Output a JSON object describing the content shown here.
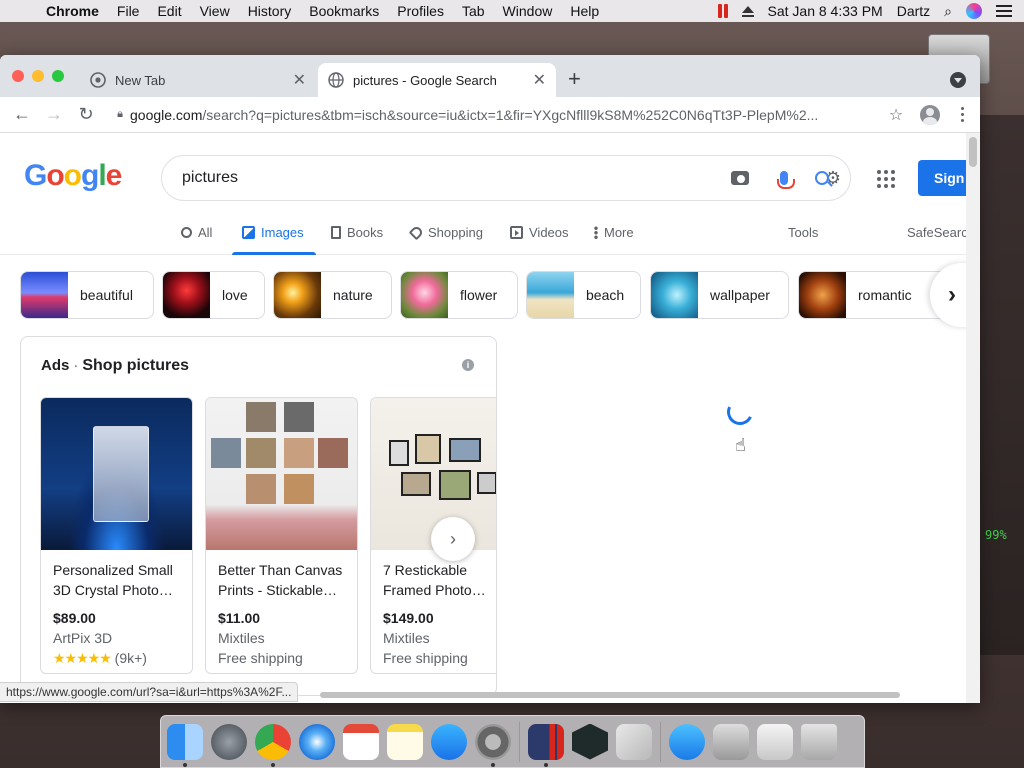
{
  "menubar": {
    "app": "Chrome",
    "items": [
      "File",
      "Edit",
      "View",
      "History",
      "Bookmarks",
      "Profiles",
      "Tab",
      "Window",
      "Help"
    ],
    "clock": "Sat Jan 8  4:33 PM",
    "user": "Dartz"
  },
  "desktop": {
    "battery_text": "99%"
  },
  "tabs": [
    {
      "title": "New Tab"
    },
    {
      "title": "pictures - Google Search"
    }
  ],
  "toolbar": {
    "url_domain": "google.com",
    "url_rest": "/search?q=pictures&tbm=isch&source=iu&ictx=1&fir=YXgcNflll9kS8M%252C0N6qTt3P-PlepM%2..."
  },
  "search": {
    "query": "pictures",
    "sign_in_label": "Sign"
  },
  "nav": {
    "all": "All",
    "images": "Images",
    "books": "Books",
    "shopping": "Shopping",
    "videos": "Videos",
    "more": "More",
    "tools": "Tools",
    "safesearch": "SafeSearch"
  },
  "chips": [
    {
      "label": "beautiful"
    },
    {
      "label": "love"
    },
    {
      "label": "nature"
    },
    {
      "label": "flower"
    },
    {
      "label": "beach"
    },
    {
      "label": "wallpaper"
    },
    {
      "label": "romantic"
    }
  ],
  "ads": {
    "ads_label": "Ads",
    "title": "Shop pictures",
    "products": [
      {
        "name": "Personalized Small 3D Crystal Photo…",
        "price": "$89.00",
        "seller": "ArtPix 3D",
        "stars": "★★★★★",
        "reviews": "(9k+)"
      },
      {
        "name": "Better Than Canvas Prints - Stickable…",
        "price": "$11.00",
        "seller": "Mixtiles",
        "shipping": "Free shipping"
      },
      {
        "name": "7 Restickable Framed Photo…",
        "price": "$149.00",
        "seller": "Mixtiles",
        "shipping": "Free shipping"
      }
    ]
  },
  "status_url": "https://www.google.com/url?sa=i&url=https%3A%2F...",
  "colors": {
    "accent": "#1a73e8",
    "google_blue": "#4285f4",
    "google_red": "#ea4335",
    "google_yellow": "#fbbc05",
    "google_green": "#34a853"
  }
}
